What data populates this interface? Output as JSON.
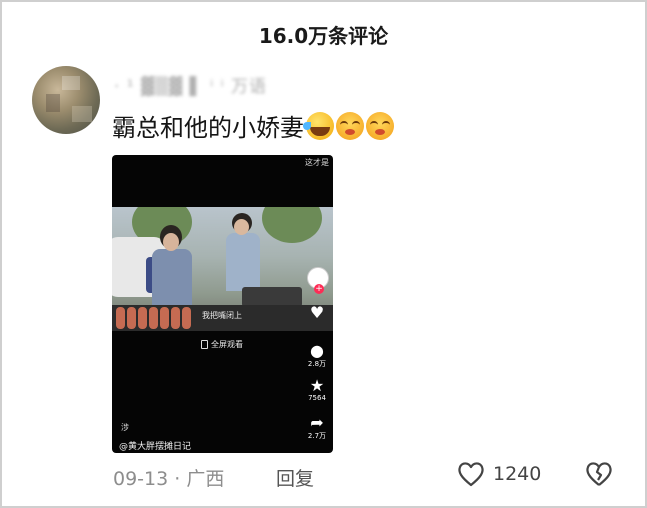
{
  "header": {
    "title": "16.0万条评论"
  },
  "comment": {
    "username": "· ¹ ▓▒▓ ▌ ⁱ ⁱ 万语",
    "text": "霸总和他的小娇妻",
    "emojis": [
      "laugh-crying-emoji",
      "blush-emoji",
      "blush-emoji"
    ],
    "date": "09-13",
    "separator": "·",
    "location": "广西",
    "reply_label": "回复",
    "like_count": "1240"
  },
  "video": {
    "top_caption": "这才是",
    "subtitle": "我把嘴闭上",
    "fullscreen_label": "全屏观看",
    "comment_count": "2.8万",
    "star_count": "7564",
    "share_count": "2.7万",
    "account": "@黄大胖摆摊日记",
    "small_text": "涉"
  }
}
